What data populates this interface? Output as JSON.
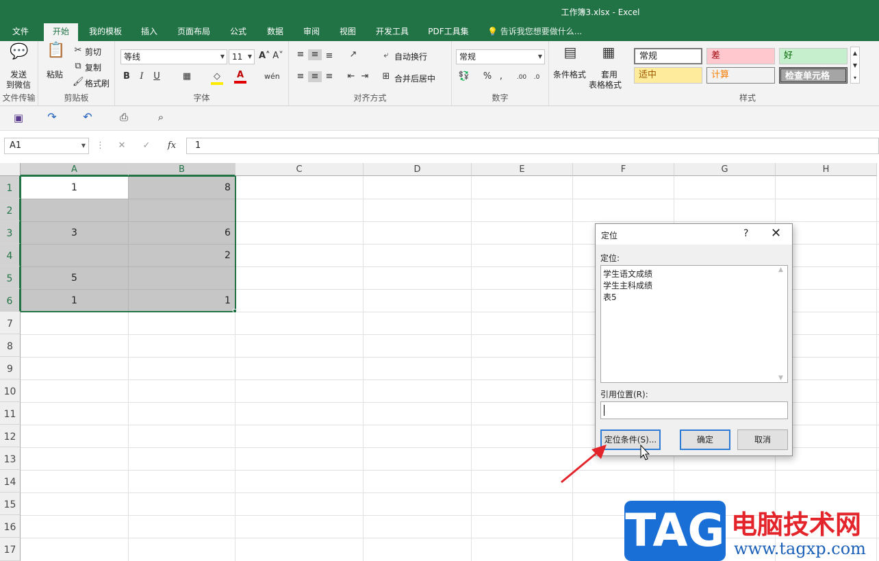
{
  "window": {
    "title": "工作簿3.xlsx - Excel"
  },
  "tabs": [
    "文件",
    "开始",
    "我的模板",
    "插入",
    "页面布局",
    "公式",
    "数据",
    "审阅",
    "视图",
    "开发工具",
    "PDF工具集"
  ],
  "tell_me": "告诉我您想要做什么...",
  "ribbon": {
    "wechat": {
      "label1": "发送",
      "label2": "到微信",
      "group": "文件传输"
    },
    "clipboard": {
      "paste": "粘贴",
      "cut": "剪切",
      "copy": "复制",
      "painter": "格式刷",
      "group": "剪贴板"
    },
    "font": {
      "name": "等线",
      "size": "11",
      "group": "字体"
    },
    "align": {
      "wrap": "自动换行",
      "merge": "合并后居中",
      "group": "对齐方式"
    },
    "number": {
      "format": "常规",
      "group": "数字"
    },
    "cond": {
      "label1": "条件格式",
      "table1": "套用",
      "table2": "表格格式"
    },
    "styles": {
      "normal": "常规",
      "bad": "差",
      "good": "好",
      "neutral": "适中",
      "calc": "计算",
      "check": "检查单元格",
      "group": "样式"
    }
  },
  "formula_bar": {
    "name_box": "A1",
    "value": "1"
  },
  "columns": [
    "A",
    "B",
    "C",
    "D",
    "E",
    "F",
    "G",
    "H"
  ],
  "rows": [
    "1",
    "2",
    "3",
    "4",
    "5",
    "6",
    "7",
    "8",
    "9",
    "10",
    "11",
    "12",
    "13",
    "14",
    "15",
    "16",
    "17"
  ],
  "cells": {
    "A1": "1",
    "B1": "8",
    "A3": "3",
    "B3": "6",
    "B4": "2",
    "A5": "5",
    "A6": "1",
    "B6": "1"
  },
  "dialog": {
    "title": "定位",
    "help": "?",
    "list_label": "定位:",
    "items": [
      "学生语文成绩",
      "学生主科成绩",
      "表5"
    ],
    "ref_label": "引用位置(R):",
    "ref_value": "",
    "special_button": "定位条件(S)...",
    "ok_button": "确定",
    "cancel_button": "取消"
  },
  "watermark": {
    "tag": "TAG",
    "cn": "电脑技术网",
    "url": "www.tagxp.com"
  },
  "colors": {
    "excel_green": "#217346",
    "selection": "#c6c6c6",
    "annotation_arrow": "#e3242b"
  }
}
